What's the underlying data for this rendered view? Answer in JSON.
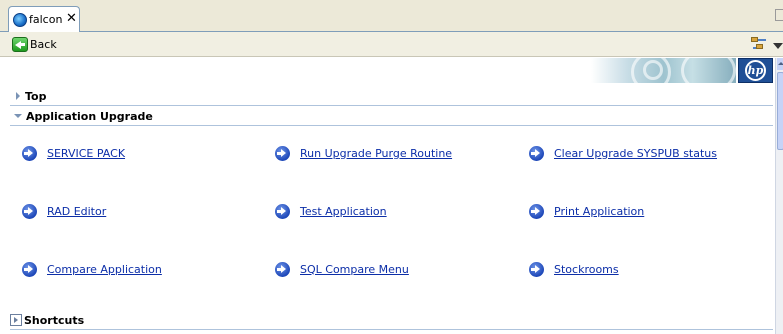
{
  "tab": {
    "title": "falcon",
    "close_glyph": "✕",
    "icon": "globe-icon"
  },
  "toolbar": {
    "back_label": "Back",
    "tree_icon": "tree-view-icon",
    "menu_icon": "view-menu-icon"
  },
  "banner": {
    "logo_text": "hp"
  },
  "sections": {
    "top": "Top",
    "upgrade": "Application Upgrade",
    "shortcuts": "Shortcuts"
  },
  "links": [
    {
      "label": "SERVICE PACK"
    },
    {
      "label": "Run Upgrade Purge Routine"
    },
    {
      "label": "Clear Upgrade SYSPUB status"
    },
    {
      "label": "RAD Editor"
    },
    {
      "label": "Test Application"
    },
    {
      "label": "Print Application"
    },
    {
      "label": "Compare Application"
    },
    {
      "label": "SQL Compare Menu"
    },
    {
      "label": "Stockrooms"
    }
  ],
  "colors": {
    "link": "#0c2ea8",
    "accent": "#1f4f96",
    "rule": "#aec3dc"
  }
}
